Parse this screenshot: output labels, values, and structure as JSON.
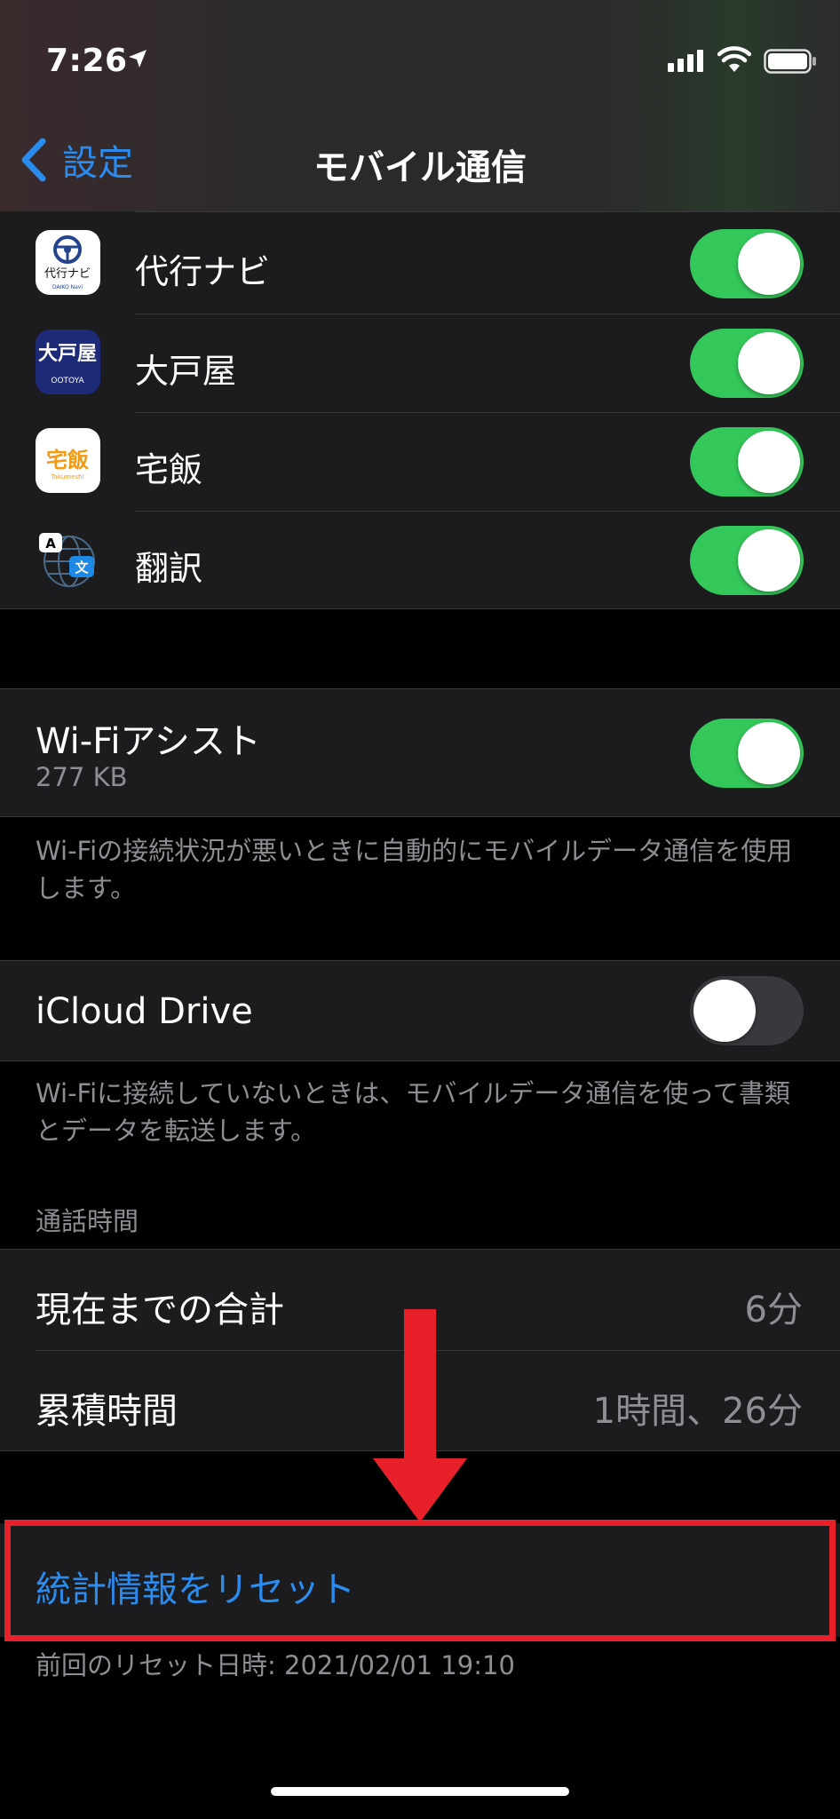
{
  "status_bar": {
    "time": "7:26"
  },
  "nav": {
    "back_label": "設定",
    "title": "モバイル通信"
  },
  "apps": [
    {
      "name": "代行ナビ",
      "enabled": true,
      "icon_caption": "代行ナビ",
      "icon_subcaption": "DAIKO Navi"
    },
    {
      "name": "大戸屋",
      "enabled": true,
      "icon_caption": "大戸屋",
      "icon_subcaption": "OOTOYA"
    },
    {
      "name": "宅飯",
      "enabled": true,
      "icon_caption": "宅飯",
      "icon_subcaption": "Takumeshi"
    },
    {
      "name": "翻訳",
      "enabled": true,
      "icon_caption": "A 文"
    }
  ],
  "wifi_assist": {
    "label": "Wi-Fiアシスト",
    "usage": "277 KB",
    "enabled": true,
    "footer": "Wi-Fiの接続状況が悪いときに自動的にモバイルデータ通信を使用します。"
  },
  "icloud_drive": {
    "label": "iCloud Drive",
    "enabled": false,
    "footer": "Wi-Fiに接続していないときは、モバイルデータ通信を使って書類とデータを転送します。"
  },
  "call_time": {
    "header": "通話時間",
    "rows": [
      {
        "label": "現在までの合計",
        "value": "6分"
      },
      {
        "label": "累積時間",
        "value": "1時間、26分"
      }
    ]
  },
  "reset": {
    "label": "統計情報をリセット",
    "last_reset": "前回のリセット日時: 2021/02/01 19:10"
  },
  "colors": {
    "accent": "#2b8cf0",
    "toggle_on": "#34c759",
    "highlight": "#e8202a",
    "cell": "#1c1c1e"
  }
}
